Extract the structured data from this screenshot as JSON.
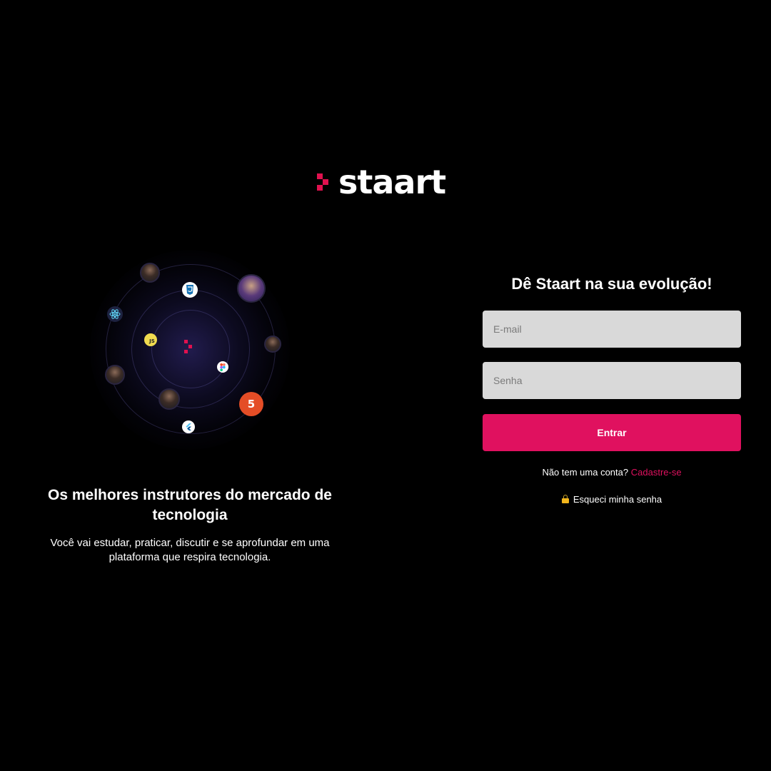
{
  "brand": {
    "name": "staart",
    "accent_color": "#e0114f"
  },
  "illustration": {
    "tech_icons": [
      "css3-icon",
      "react-icon",
      "javascript-icon",
      "figma-icon",
      "html5-icon",
      "flutter-icon"
    ],
    "js_label": "JS",
    "html_label": "5"
  },
  "left_panel": {
    "title": "Os melhores instrutores do mercado de tecnologia",
    "description": "Você vai estudar, praticar, discutir e se aprofundar em uma plataforma que respira tecnologia."
  },
  "login_form": {
    "title": "Dê Staart na sua evolução!",
    "email_placeholder": "E-mail",
    "password_placeholder": "Senha",
    "submit_label": "Entrar",
    "signup_prompt": "Não tem uma conta?",
    "signup_link": "Cadastre-se",
    "forgot_password": "Esqueci minha senha"
  },
  "colors": {
    "background": "#000000",
    "primary_button": "#e0115f",
    "input_background": "#d9d9d9"
  }
}
